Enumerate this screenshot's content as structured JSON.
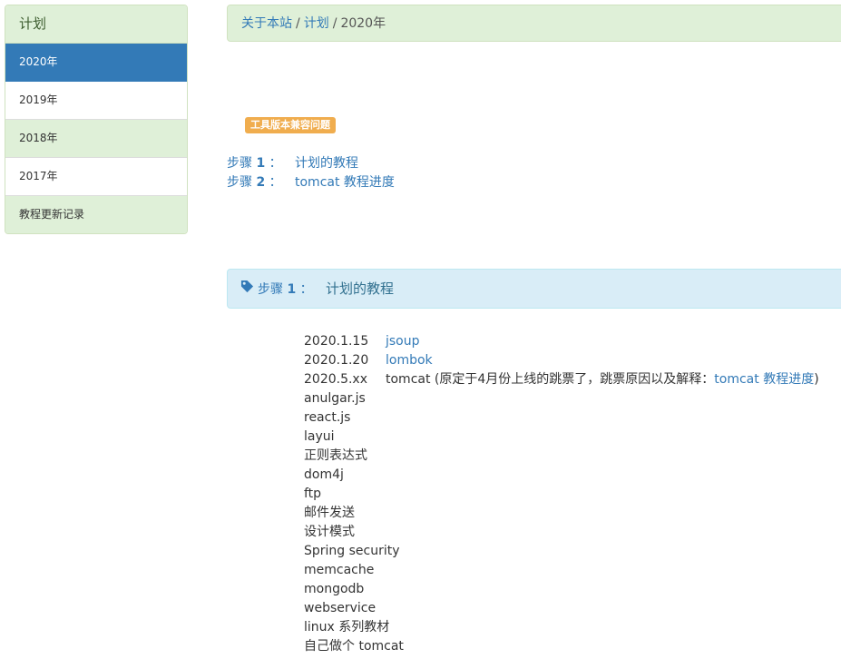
{
  "sidebar": {
    "title": "计划",
    "items": [
      {
        "label": "2020年"
      },
      {
        "label": "2019年"
      },
      {
        "label": "2018年"
      },
      {
        "label": "2017年"
      },
      {
        "label": "教程更新记录"
      }
    ]
  },
  "breadcrumb": {
    "home": "关于本站",
    "section": "计划",
    "current": "2020年",
    "separator": "/"
  },
  "badge": {
    "label": "工具版本兼容问题",
    "color": "#f0ad4e"
  },
  "steps": [
    {
      "prefix": "步骤",
      "num": "1",
      "suffix": "：",
      "link": "计划的教程"
    },
    {
      "prefix": "步骤",
      "num": "2",
      "suffix": "：",
      "link": "tomcat 教程进度"
    }
  ],
  "panel": {
    "prefix": "步骤",
    "num": "1",
    "suffix": "：",
    "title": "计划的教程",
    "icon": "tag-icon"
  },
  "items": {
    "dated": [
      {
        "date": "2020.1.15",
        "link": "jsoup"
      },
      {
        "date": "2020.1.20",
        "link": "lombok"
      }
    ],
    "tomcat": {
      "date": "2020.5.xx",
      "text": "tomcat (原定于4月份上线的跳票了，跳票原因以及解释：",
      "link": "tomcat 教程进度",
      "close": ")"
    },
    "plain": [
      "anulgar.js",
      "react.js",
      "layui",
      "正则表达式",
      "dom4j",
      "ftp",
      "邮件发送",
      "设计模式",
      "Spring security",
      "memcache",
      "mongodb",
      "webservice",
      "linux 系列教材",
      "自己做个 tomcat"
    ]
  },
  "colors": {
    "link": "#337ab7",
    "active": "#337ab7",
    "green_bg": "#dff0d8",
    "info_bg": "#d9edf7"
  }
}
